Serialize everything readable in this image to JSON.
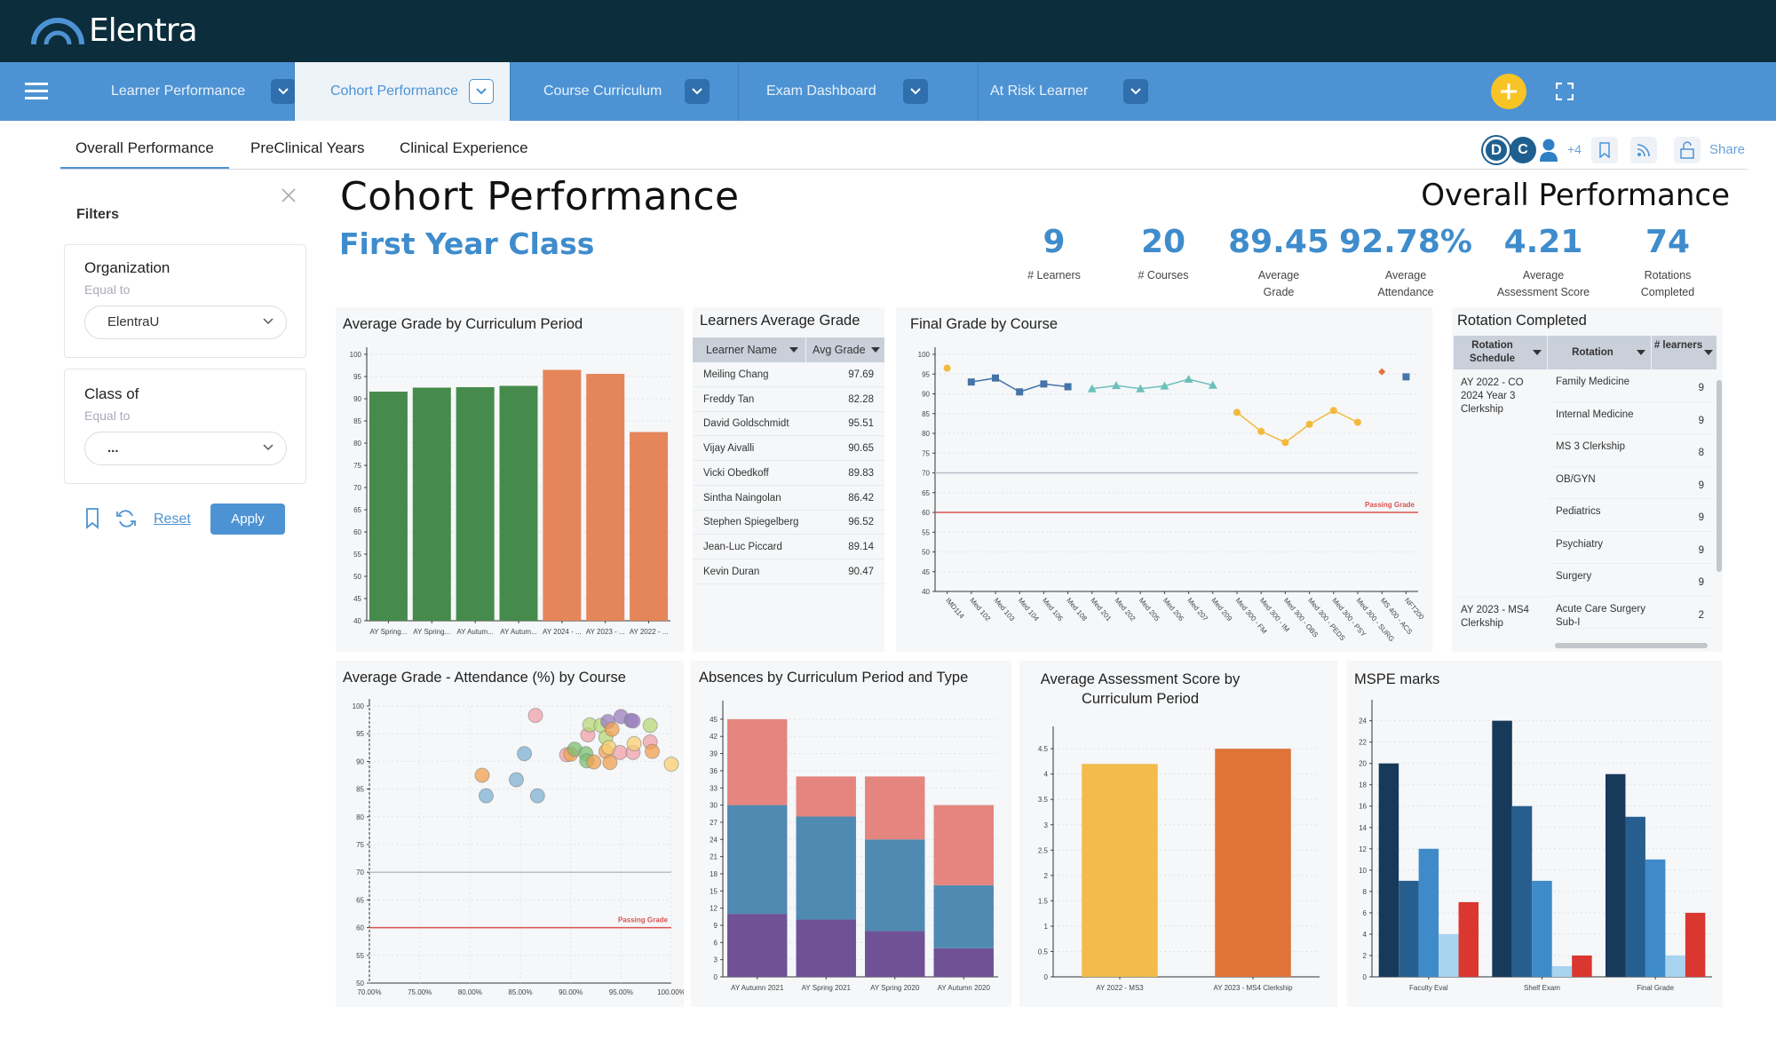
{
  "app": {
    "logo_text": "Elentra"
  },
  "nav": {
    "items": [
      {
        "label": "Learner Performance",
        "active": false
      },
      {
        "label": "Cohort Performance",
        "active": true
      },
      {
        "label": "Course Curriculum",
        "active": false
      },
      {
        "label": "Exam Dashboard",
        "active": false
      },
      {
        "label": "At Risk Learner",
        "active": false
      }
    ],
    "add_icon": "plus-circle-icon",
    "expand_icon": "fullscreen-icon",
    "accent": "#4d93d3",
    "add_color": "#f7c325"
  },
  "subtabs": [
    {
      "label": "Overall Performance",
      "active": true
    },
    {
      "label": "PreClinical Years",
      "active": false
    },
    {
      "label": "Clinical Experience",
      "active": false
    }
  ],
  "toolbar": {
    "avatars": [
      "D",
      "C"
    ],
    "more_users": "+4",
    "share_label": "Share"
  },
  "filters": {
    "title": "Filters",
    "organization": {
      "label": "Organization",
      "operator": "Equal to",
      "value": "ElentraU"
    },
    "class_of": {
      "label": "Class of",
      "operator": "Equal to",
      "value": "..."
    },
    "reset_label": "Reset",
    "apply_label": "Apply"
  },
  "header": {
    "title": "Cohort Performance",
    "subtitle": "First Year Class",
    "section": "Overall Performance"
  },
  "kpis": [
    {
      "value": "9",
      "label": "#   Learners"
    },
    {
      "value": "20",
      "label": "#   Courses"
    },
    {
      "value": "89.45",
      "label": "Average\nGrade"
    },
    {
      "value": "92.78%",
      "label": "Average\nAttendance"
    },
    {
      "value": "4.21",
      "label": "Average\nAssessment Score"
    },
    {
      "value": "74",
      "label": "Rotations\nCompleted"
    }
  ],
  "learners_table": {
    "title": "Learners Average Grade",
    "columns": [
      "Learner Name",
      "Avg Grade"
    ],
    "rows": [
      [
        "Meiling Chang",
        "97.69"
      ],
      [
        "Freddy Tan",
        "82.28"
      ],
      [
        "David Goldschmidt",
        "95.51"
      ],
      [
        "Vijay Aivalli",
        "90.65"
      ],
      [
        "Vicki Obedkoff",
        "89.83"
      ],
      [
        "Sintha Naingolan",
        "86.42"
      ],
      [
        "Stephen Spiegelberg",
        "96.52"
      ],
      [
        "Jean-Luc Piccard",
        "89.14"
      ],
      [
        "Kevin Duran",
        "90.47"
      ]
    ]
  },
  "rotation_table": {
    "title": "Rotation Completed",
    "columns": [
      "Rotation Schedule",
      "Rotation",
      "# learners"
    ],
    "groups": [
      {
        "schedule": "AY 2022 - CO 2024 Year 3 Clerkship",
        "rows": [
          [
            "Family Medicine",
            "9"
          ],
          [
            "Internal Medicine",
            "9"
          ],
          [
            "MS 3 Clerkship",
            "8"
          ],
          [
            "OB/GYN",
            "9"
          ],
          [
            "Pediatrics",
            "9"
          ],
          [
            "Psychiatry",
            "9"
          ],
          [
            "Surgery",
            "9"
          ]
        ]
      },
      {
        "schedule": "AY 2023 - MS4 Clerkship",
        "rows": [
          [
            "Acute Care Surgery Sub-I",
            "2"
          ]
        ]
      }
    ]
  },
  "chart_data": [
    {
      "type": "bar",
      "title": "Average Grade by Curriculum Period",
      "categories": [
        "AY Spring...",
        "AY Spring...",
        "AY Autum...",
        "AY Autum...",
        "AY 2024 - ...",
        "AY 2023 - ...",
        "AY 2022 - ..."
      ],
      "values": [
        91.6,
        92.5,
        92.6,
        92.9,
        96.5,
        95.6,
        82.5
      ],
      "colors": [
        "#468b4c",
        "#468b4c",
        "#468b4c",
        "#468b4c",
        "#e5855a",
        "#e5855a",
        "#e5855a"
      ],
      "ylim": [
        40,
        100
      ],
      "yticks": [
        40,
        45,
        50,
        55,
        60,
        65,
        70,
        75,
        80,
        85,
        90,
        95,
        100
      ],
      "grid": true
    },
    {
      "type": "line",
      "title": "Final Grade by Course",
      "categories": [
        "IMD114",
        "Med 102",
        "Med 103",
        "Med 104",
        "Med 106",
        "Med 108",
        "Med 201",
        "Med 202",
        "Med 205",
        "Med 206",
        "Med 207",
        "Med 209",
        "Med 300 - FM",
        "Med 300 - IM",
        "Med 300 - OBS",
        "Med 300 - PEDS",
        "Med 300 - PSY",
        "Med 300 - SURG",
        "MS 400 - ACS",
        "NFT200"
      ],
      "series": [
        {
          "marker": "circle",
          "color": "#f2b93b",
          "courses": [
            "IMD114"
          ],
          "values": [
            96.5
          ]
        },
        {
          "marker": "square",
          "color": "#4574a8",
          "courses": [
            "Med 102",
            "Med 103",
            "Med 104",
            "Med 106",
            "Med 108"
          ],
          "values": [
            93.0,
            94.0,
            90.5,
            92.5,
            91.8
          ]
        },
        {
          "marker": "triangle",
          "color": "#6cc0bc",
          "courses": [
            "Med 201",
            "Med 202",
            "Med 205",
            "Med 206",
            "Med 207",
            "Med 209"
          ],
          "values": [
            91.3,
            92.1,
            91.3,
            92.0,
            93.7,
            92.2
          ]
        },
        {
          "marker": "circle",
          "color": "#f2b93b",
          "courses": [
            "Med 300 - FM",
            "Med 300 - IM",
            "Med 300 - OBS",
            "Med 300 - PEDS",
            "Med 300 - PSY",
            "Med 300 - SURG"
          ],
          "values": [
            85.3,
            80.5,
            77.7,
            82.3,
            85.8,
            82.8
          ]
        },
        {
          "marker": "diamond",
          "color": "#e0733a",
          "courses": [
            "MS 400 - ACS"
          ],
          "values": [
            95.6
          ]
        },
        {
          "marker": "square",
          "color": "#4574a8",
          "courses": [
            "NFT200"
          ],
          "values": [
            94.3
          ]
        }
      ],
      "reference_lines": [
        {
          "value": 70,
          "color": "#b9bec5",
          "label": ""
        },
        {
          "value": 60,
          "color": "#d9534f",
          "label": "Passing Grade"
        }
      ],
      "ylim": [
        40,
        100
      ],
      "yticks": [
        40,
        45,
        50,
        55,
        60,
        65,
        70,
        75,
        80,
        85,
        90,
        95,
        100
      ],
      "grid": true
    },
    {
      "type": "scatter",
      "title": "Average Grade - Attendance (%) by Course",
      "xlim": [
        70,
        100
      ],
      "xticks": [
        "70.00%",
        "75.00%",
        "80.00%",
        "85.00%",
        "90.00%",
        "95.00%",
        "100.00%"
      ],
      "ylim": [
        50,
        100
      ],
      "yticks": [
        50,
        55,
        60,
        65,
        70,
        75,
        80,
        85,
        90,
        95,
        100
      ],
      "points": [
        [
          86.5,
          98.3,
          "#f0a0a8"
        ],
        [
          81.2,
          87.5,
          "#f0a050"
        ],
        [
          81.6,
          83.8,
          "#7fb0d0"
        ],
        [
          84.6,
          86.7,
          "#7fb0d0"
        ],
        [
          85.4,
          91.4,
          "#7fb0d0"
        ],
        [
          86.7,
          83.8,
          "#7fb0d0"
        ],
        [
          89.6,
          91.2,
          "#f0a0a8"
        ],
        [
          90.0,
          91.3,
          "#f0a050"
        ],
        [
          90.4,
          92.2,
          "#7cc070"
        ],
        [
          91.5,
          91.4,
          "#7cc070"
        ],
        [
          91.6,
          90.1,
          "#7cc070"
        ],
        [
          91.7,
          94.8,
          "#f0a0a8"
        ],
        [
          91.9,
          96.6,
          "#b8d878"
        ],
        [
          92.3,
          89.9,
          "#f0a050"
        ],
        [
          93.0,
          96.5,
          "#b8d878"
        ],
        [
          93.5,
          94.3,
          "#b8d878"
        ],
        [
          93.5,
          91.8,
          "#f0a050"
        ],
        [
          93.7,
          97.2,
          "#9b7fc0"
        ],
        [
          93.8,
          92.5,
          "#f8d070"
        ],
        [
          93.9,
          89.8,
          "#f0a050"
        ],
        [
          94.1,
          95.8,
          "#f0a050"
        ],
        [
          94.9,
          91.6,
          "#f0a0a8"
        ],
        [
          95.0,
          98.1,
          "#9b7fc0"
        ],
        [
          96.0,
          97.4,
          "#9b7fc0"
        ],
        [
          96.2,
          97.3,
          "#9b7fc0"
        ],
        [
          96.2,
          91.6,
          "#f0a0a8"
        ],
        [
          96.3,
          93.2,
          "#f8d070"
        ],
        [
          97.9,
          96.5,
          "#b8d878"
        ],
        [
          97.9,
          93.5,
          "#f0a0a8"
        ],
        [
          98.1,
          91.8,
          "#f0a050"
        ],
        [
          100.0,
          89.5,
          "#f8d070"
        ]
      ],
      "reference_lines": [
        {
          "value": 70,
          "color": "#b9bec5",
          "label": ""
        },
        {
          "value": 60,
          "color": "#d9534f",
          "label": "Passing Grade"
        }
      ],
      "grid": true
    },
    {
      "type": "bar",
      "stacked": true,
      "title": "Absences by Curriculum Period and Type",
      "categories": [
        "AY Autumn 2021",
        "AY Spring 2021",
        "AY Spring 2020",
        "AY Autumn 2020"
      ],
      "series": [
        {
          "color": "#6f5196",
          "values": [
            11,
            10,
            8,
            5
          ]
        },
        {
          "color": "#4f8ab2",
          "values": [
            19,
            18,
            16,
            11
          ]
        },
        {
          "color": "#e4857f",
          "values": [
            15,
            7,
            11,
            14
          ]
        }
      ],
      "ylim": [
        0,
        47
      ],
      "yticks": [
        0,
        3,
        6,
        9,
        12,
        15,
        18,
        21,
        24,
        27,
        30,
        33,
        36,
        39,
        42,
        45
      ],
      "grid": true
    },
    {
      "type": "bar",
      "title": "Average Assessment Score by Curriculum Period",
      "categories": [
        "AY 2022 - MS3",
        "AY 2023 - MS4 Clerkship"
      ],
      "values": [
        4.2,
        4.5
      ],
      "colors": [
        "#f2bb4c",
        "#e07438"
      ],
      "ylim": [
        0,
        4.8
      ],
      "yticks": [
        0,
        0.5,
        1,
        1.5,
        2,
        2.5,
        3,
        3.5,
        4,
        4.5
      ],
      "grid": true
    },
    {
      "type": "bar",
      "grouped": true,
      "title": "MSPE marks",
      "categories": [
        "Faculty Eval",
        "Shelf Exam",
        "Final Grade"
      ],
      "series": [
        {
          "color": "#17395a",
          "values": [
            20,
            24,
            19
          ]
        },
        {
          "color": "#265f8f",
          "values": [
            9,
            16,
            15
          ]
        },
        {
          "color": "#3f8bc9",
          "values": [
            12,
            9,
            11
          ]
        },
        {
          "color": "#a8d4f0",
          "values": [
            4,
            1,
            2
          ]
        },
        {
          "color": "#d9372f",
          "values": [
            7,
            2,
            6
          ]
        }
      ],
      "ylim": [
        0,
        25.3
      ],
      "yticks": [
        0,
        2,
        4,
        6,
        8,
        10,
        12,
        14,
        16,
        18,
        20,
        22,
        24
      ],
      "grid": true
    }
  ]
}
